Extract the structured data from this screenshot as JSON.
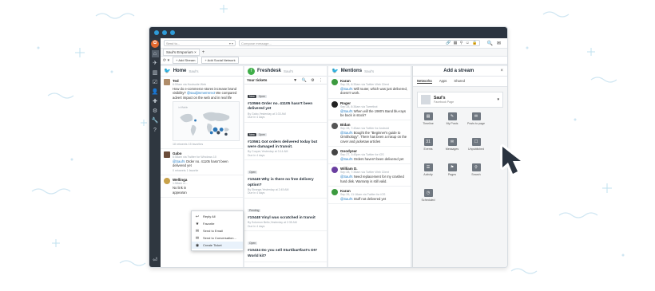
{
  "app": {
    "compose": {
      "send_to_placeholder": "Send to...",
      "send_to_caret": "▾ ▾",
      "message_placeholder": "Compose message...",
      "tools": "🔗 ▦ ⚲ ☺ 🔒"
    },
    "top_icons": [
      "🔍",
      "✉"
    ],
    "tabs": [
      {
        "label": "Saul's Emporium"
      }
    ],
    "tab_close": "×",
    "tab_add": "+",
    "actions": {
      "refresh": "⟳ ▾",
      "add_stream": "+ Add Stream",
      "add_network": "+ Add Social Network"
    }
  },
  "sidebar": {
    "logo": "✿",
    "icons": [
      "⌂",
      "✈",
      "▥",
      "☑",
      "👤",
      "✚",
      "⚙",
      "🔧",
      "?"
    ],
    "bottom": "⏎"
  },
  "streams": {
    "home": {
      "title": "Home",
      "sub": "Saul's",
      "posts": [
        {
          "author": "Ted",
          "meta": "6:59am via Hootsuite Web",
          "text_pre": "How do e-commerce stores increase brand visibility? ",
          "mention": "@sauljimmerrerect",
          "text_post": " We compared advert impact on the web and in real life",
          "counts": "18 retweets    15 favorites"
        },
        {
          "author": "Gabo",
          "meta": "6:58am via Twitter for Windows 10",
          "text_pre": "",
          "mention": "@Saul's",
          "text_post": " Order no. 41105 hasn't been delivered yet",
          "counts": "0 retweets    1 favorite"
        },
        {
          "author": "Wellinga",
          "meta": "1:58am vi...",
          "text_pre": "No link in\nappearan",
          "mention": "",
          "text_post": "",
          "counts": ""
        }
      ],
      "map_label": "in Mobile"
    },
    "freshdesk": {
      "title": "Freshdesk",
      "sub": "Saul's",
      "logo": "f",
      "bar_label": "Your tickets",
      "bar_icons": "▼ 🔍 ⚙ ⋮",
      "tickets": [
        {
          "badges": [
            "New",
            "Open"
          ],
          "title": "#10566 Order no. 41105 hasn't been delivered yet",
          "meta": "By Gabo,Yesterday at 3:33 AM\nDue in 4 days"
        },
        {
          "badges": [
            "New",
            "Open"
          ],
          "title": "#10561 Got orders delivered today but were damaged in transit.",
          "meta": "By Cooper,Yesterday at 3:14 AM\nDue in 4 days"
        },
        {
          "badges": [
            "Open"
          ],
          "title": "#10449 Why is there no free delivery option?",
          "meta": "By Strange,Yesterday at 2:45 AM\nDue in 4 days"
        },
        {
          "badges": [
            "Pending"
          ],
          "title": "#10448 Vinyl was scratched in transit",
          "meta": "By Solomon Bello,Yesterday at 2:35 AM\nDue in 4 days"
        },
        {
          "badges": [
            "Open"
          ],
          "title": "#10434 Do you sell Startibartfast's DIY World kit?",
          "meta": ""
        }
      ]
    },
    "mentions": {
      "title": "Mentions",
      "sub": "Saul's",
      "posts": [
        {
          "author": "Karan",
          "meta": "Sep 28, 8:35am via Twitter Web Client",
          "mention": "@Saul's",
          "text": " Will router, which was just delivered, doesn't work.",
          "color": "#3c9a3f"
        },
        {
          "author": "Roger",
          "meta": "Sep 28, 8:36am via Tweetbot",
          "mention": "@Saul's",
          "text": " When will the 1980's Band blu-rays be back in stock?",
          "color": "#222222"
        },
        {
          "author": "Bidan",
          "meta": "Sep 28, 7:45am via Twitter for Android",
          "mention": "@Saul's",
          "text": " Bought the \"Beginner's guide to Ornithology\". There has been a mixup on the cover and jacketaw articles",
          "color": "#555555"
        },
        {
          "author": "Goodyear",
          "meta": "Sep 27, 3:45pm via Twitter for iOS",
          "mention": "@Saul's",
          "text": " Orders haven't been delivered yet",
          "color": "#444444"
        },
        {
          "author": "William D.",
          "meta": "Sep 28, 7:35am via Twitter Web Client",
          "mention": "@Saul's",
          "text": " Need replacement for my crashed hard disk. Warranty is still valid.",
          "color": "#6a3fa0"
        },
        {
          "author": "Karan",
          "meta": "Sep 26, 11:16am via Twitter for iOS",
          "mention": "@Saul's",
          "text": " Stuff not delivered yet",
          "color": "#3c9a3f"
        }
      ]
    }
  },
  "add_stream": {
    "title": "Add a stream",
    "close": "×",
    "tabs": [
      "Networks",
      "Apps",
      "Shared"
    ],
    "profile": {
      "name": "Saul's",
      "type": "Facebook Page"
    },
    "items": [
      {
        "label": "Timeline",
        "icon": "▤"
      },
      {
        "label": "My Posts",
        "icon": "✎"
      },
      {
        "label": "Posts to page",
        "icon": "✉"
      },
      {
        "label": "Events",
        "icon": "31"
      },
      {
        "label": "Messages",
        "icon": "✉"
      },
      {
        "label": "Unpublished",
        "icon": "☐"
      },
      {
        "label": "Activity",
        "icon": "☰"
      },
      {
        "label": "Pages",
        "icon": "⚑"
      },
      {
        "label": "Search",
        "icon": "⚲"
      },
      {
        "label": "Scheduled",
        "icon": "◷"
      }
    ]
  },
  "context_menu": {
    "items": [
      {
        "label": "Reply All",
        "icon": "↩"
      },
      {
        "label": "Favorite",
        "icon": "★"
      },
      {
        "label": "Send to Email",
        "icon": "✉"
      },
      {
        "label": "Send to Conversation...",
        "icon": "✉"
      },
      {
        "label": "Create Ticket",
        "icon": "◉"
      }
    ]
  },
  "colors": {
    "window_chrome": "#2b3440",
    "traffic_dot": "#2e9bd8",
    "sidebar": "#2f3740",
    "twitter": "#1da1f2",
    "freshdesk": "#3fae49",
    "hootsuite_logo": "#e2692e"
  }
}
